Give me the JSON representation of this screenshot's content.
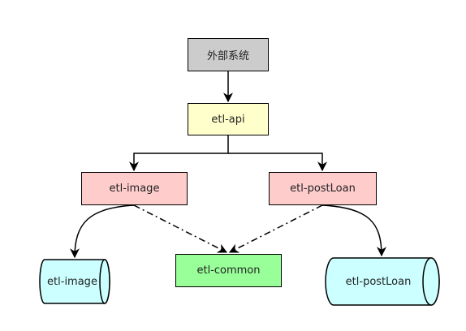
{
  "nodes": {
    "external": "外部系统",
    "api": "etl-api",
    "image": "etl-image",
    "postloan": "etl-postLoan",
    "common": "etl-common"
  },
  "databases": {
    "image": "etl-image",
    "postloan": "etl-postLoan"
  },
  "colors": {
    "external": "#cccccc",
    "api": "#ffffcc",
    "service": "#ffcccc",
    "common": "#99ff99",
    "database": "#ccffff"
  }
}
